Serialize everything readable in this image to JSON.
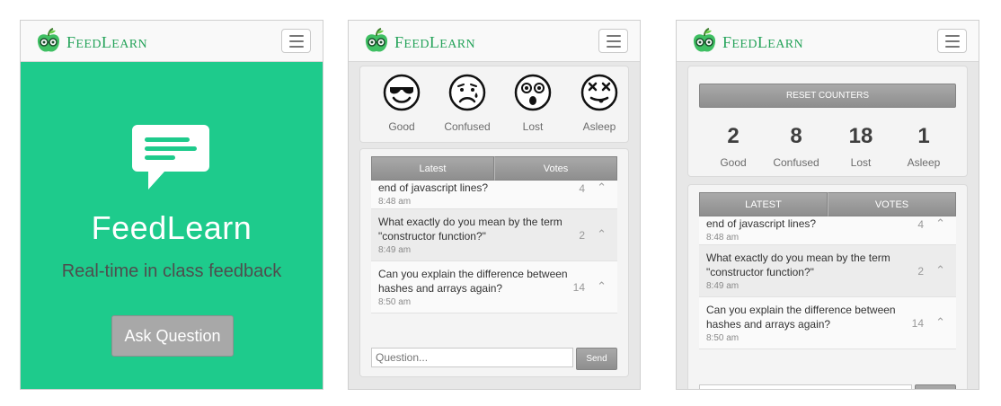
{
  "brand": {
    "name_first": "F",
    "name_mid": "EED",
    "name_second": "L",
    "name_rest": "EARN",
    "color": "#25a35a"
  },
  "landing": {
    "title": "FeedLearn",
    "subtitle": "Real-time in class feedback",
    "ask_button": "Ask Question",
    "bg_color": "#1ecb8c"
  },
  "moods": [
    {
      "label": "Good",
      "icon": "sunglasses-face-icon"
    },
    {
      "label": "Confused",
      "icon": "worried-face-icon"
    },
    {
      "label": "Lost",
      "icon": "shocked-face-icon"
    },
    {
      "label": "Asleep",
      "icon": "dizzy-face-icon"
    }
  ],
  "teacher": {
    "reset_label": "RESET COUNTERS",
    "counts": [
      {
        "value": "2",
        "label": "Good"
      },
      {
        "value": "8",
        "label": "Confused"
      },
      {
        "value": "18",
        "label": "Lost"
      },
      {
        "value": "1",
        "label": "Asleep"
      }
    ],
    "tabs": [
      "LATEST",
      "VOTES"
    ]
  },
  "student": {
    "tabs": [
      "Latest",
      "Votes"
    ],
    "question_placeholder": "Question...",
    "send_label": "Send"
  },
  "questions": [
    {
      "text": "end of javascript lines?",
      "time": "8:48 am",
      "votes": "4"
    },
    {
      "text": "What exactly do you mean by the term \"constructor function?\"",
      "time": "8:49 am",
      "votes": "2"
    },
    {
      "text": "Can you explain the difference between hashes and arrays again?",
      "time": "8:50 am",
      "votes": "14"
    }
  ]
}
